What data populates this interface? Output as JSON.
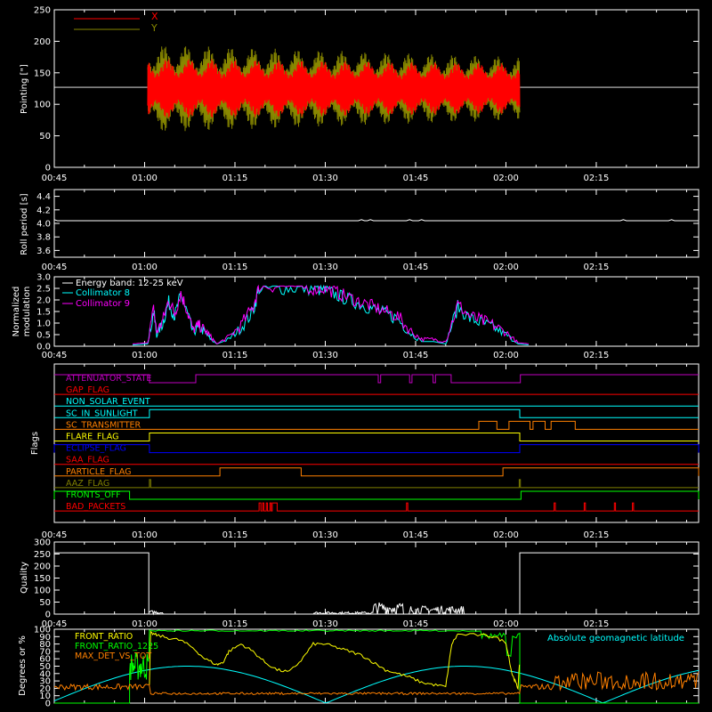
{
  "time_axis": {
    "start_min": 45,
    "end_min": 152,
    "tick_minutes": [
      45,
      60,
      75,
      90,
      105,
      120,
      135
    ],
    "tick_labels": [
      "00:45",
      "01:00",
      "01:15",
      "01:30",
      "01:45",
      "02:00",
      "02:15"
    ]
  },
  "colors": {
    "x": "#ff0000",
    "y": "#888800",
    "white": "#ffffff",
    "cyan": "#00ffff",
    "magenta": "#ff00ff",
    "yellow": "#ffff00",
    "green": "#00ff00",
    "orange": "#ff8000",
    "red": "#ff0000",
    "blue": "#0000ff",
    "olive": "#808000",
    "purple": "#c000c0"
  },
  "chart_data": [
    {
      "type": "line",
      "ylabel": "Pointing [\"]",
      "ylim": [
        0,
        250
      ],
      "yticks": [
        "0",
        "50",
        "100",
        "150",
        "200",
        "250"
      ],
      "reference_level": 127,
      "legend_position": "top-left",
      "series": [
        {
          "name": "X",
          "color": "#ff0000",
          "t_start": 60.5,
          "t_end": 122.3,
          "center": 125,
          "amplitude_start": 48,
          "amplitude_end": 40
        },
        {
          "name": "Y",
          "color": "#888800",
          "t_start": 60.5,
          "t_end": 122.3,
          "center": 125,
          "amplitude_start": 70,
          "amplitude_end": 50
        }
      ]
    },
    {
      "type": "line",
      "ylabel": "Roll period [s]",
      "ylim": [
        3.5,
        4.5
      ],
      "yticks": [
        "3.6",
        "3.8",
        "4.0",
        "4.2",
        "4.4"
      ],
      "series": [
        {
          "name": "",
          "color": "#ffffff",
          "value": 4.04
        }
      ]
    },
    {
      "type": "line",
      "ylabel": "Normalized modulation",
      "ylim": [
        0,
        3.0
      ],
      "yticks": [
        "0.0",
        "0.5",
        "1.0",
        "1.5",
        "2.0",
        "2.5",
        "3.0"
      ],
      "legend_position": "top-left",
      "legend_title": "Energy band: 12-25 keV",
      "series": [
        {
          "name": "Collimator 8",
          "color": "#00ffff",
          "points": [
            [
              58,
              0.05
            ],
            [
              60.5,
              0.1
            ],
            [
              61.5,
              1.5
            ],
            [
              62,
              0.5
            ],
            [
              63,
              1.0
            ],
            [
              64,
              1.9
            ],
            [
              65,
              1.3
            ],
            [
              66,
              2.2
            ],
            [
              67,
              1.5
            ],
            [
              68,
              0.6
            ],
            [
              69,
              0.8
            ],
            [
              70,
              0.6
            ],
            [
              71,
              0.3
            ],
            [
              72,
              0.1
            ],
            [
              74,
              0.3
            ],
            [
              76,
              0.8
            ],
            [
              78,
              1.5
            ],
            [
              79,
              2.5
            ],
            [
              82,
              2.5
            ],
            [
              85,
              2.5
            ],
            [
              88,
              2.5
            ],
            [
              90,
              2.4
            ],
            [
              92,
              2.2
            ],
            [
              94,
              2.0
            ],
            [
              96,
              1.8
            ],
            [
              98,
              1.6
            ],
            [
              100,
              1.4
            ],
            [
              102,
              1.2
            ],
            [
              104,
              0.6
            ],
            [
              106,
              0.2
            ],
            [
              108,
              0.2
            ],
            [
              110,
              0.1
            ],
            [
              112,
              1.7
            ],
            [
              114,
              1.2
            ],
            [
              116,
              1.0
            ],
            [
              118,
              0.8
            ],
            [
              120,
              0.5
            ],
            [
              122,
              0.1
            ],
            [
              124,
              0.05
            ]
          ]
        },
        {
          "name": "Collimator 9",
          "color": "#ff00ff",
          "points": [
            [
              58,
              0.1
            ],
            [
              60.5,
              0.15
            ],
            [
              61.5,
              1.6
            ],
            [
              62,
              0.6
            ],
            [
              63,
              1.1
            ],
            [
              64,
              2.0
            ],
            [
              65,
              1.4
            ],
            [
              66,
              2.3
            ],
            [
              67,
              1.6
            ],
            [
              68,
              0.7
            ],
            [
              69,
              0.9
            ],
            [
              70,
              0.7
            ],
            [
              71,
              0.4
            ],
            [
              72,
              0.1
            ],
            [
              74,
              0.4
            ],
            [
              76,
              0.9
            ],
            [
              78,
              1.7
            ],
            [
              79,
              2.6
            ],
            [
              82,
              2.6
            ],
            [
              85,
              2.6
            ],
            [
              88,
              2.5
            ],
            [
              90,
              2.5
            ],
            [
              92,
              2.3
            ],
            [
              94,
              2.1
            ],
            [
              96,
              1.9
            ],
            [
              98,
              1.7
            ],
            [
              100,
              1.5
            ],
            [
              102,
              1.3
            ],
            [
              104,
              0.7
            ],
            [
              106,
              0.3
            ],
            [
              108,
              0.3
            ],
            [
              110,
              0.2
            ],
            [
              112,
              1.8
            ],
            [
              114,
              1.3
            ],
            [
              116,
              1.1
            ],
            [
              118,
              0.9
            ],
            [
              120,
              0.6
            ],
            [
              122,
              0.15
            ],
            [
              124,
              0.1
            ]
          ]
        }
      ]
    },
    {
      "type": "line",
      "ylabel": "Flags",
      "flags": [
        {
          "name": "ATTENUATOR_STATE",
          "color": "#c000c0",
          "high_intervals": [
            [
              45,
              60.8
            ],
            [
              68.5,
              98.8
            ],
            [
              99.2,
              104
            ],
            [
              104.4,
              107.9
            ],
            [
              108.3,
              110.9
            ],
            [
              111.3,
              122.4
            ],
            [
              122.4,
              152
            ]
          ],
          "base_state": "high_default"
        },
        {
          "name": "GAP_FLAG",
          "color": "#ff0000",
          "high_intervals": []
        },
        {
          "name": "NON_SOLAR_EVENT",
          "color": "#00ffff",
          "high_intervals": []
        },
        {
          "name": "SC_IN_SUNLIGHT",
          "color": "#00ffff",
          "high_intervals": [
            [
              60.8,
              122.3
            ]
          ]
        },
        {
          "name": "SC_TRANSMITTER",
          "color": "#ff8000",
          "high_intervals": [
            [
              115.5,
              118.5
            ],
            [
              120.5,
              124
            ],
            [
              124.5,
              126.5
            ],
            [
              127.5,
              131.5
            ]
          ]
        },
        {
          "name": "FLARE_FLAG",
          "color": "#ffff00",
          "high_intervals": [
            [
              60.8,
              122.3
            ]
          ]
        },
        {
          "name": "ECLIPSE_FLAG",
          "color": "#0000ff",
          "high_intervals": [
            [
              45,
              60.8
            ],
            [
              122.3,
              152
            ]
          ]
        },
        {
          "name": "SAA_FLAG",
          "color": "#ff0000",
          "high_intervals": []
        },
        {
          "name": "PARTICLE_FLAG",
          "color": "#ff8000",
          "high_intervals": [
            [
              72.5,
              86
            ],
            [
              119.5,
              152
            ]
          ]
        },
        {
          "name": "AAZ_FLAG",
          "color": "#808000",
          "high_intervals": [
            [
              60.8,
              61
            ],
            [
              122.2,
              122.4
            ]
          ]
        },
        {
          "name": "FRONTS_OFF",
          "color": "#00ff00",
          "high_intervals": [
            [
              45,
              57.5
            ],
            [
              122.5,
              152
            ]
          ]
        },
        {
          "name": "BAD_PACKETS",
          "color": "#ff0000",
          "high_intervals": [
            [
              79,
              79.3
            ],
            [
              79.6,
              79.8
            ],
            [
              80.2,
              80.4
            ],
            [
              80.8,
              81
            ],
            [
              81.2,
              82
            ],
            [
              103.5,
              103.7
            ],
            [
              128,
              128.2
            ],
            [
              133,
              133.2
            ],
            [
              138,
              138.2
            ],
            [
              141,
              141.2
            ]
          ]
        }
      ]
    },
    {
      "type": "line",
      "ylabel": "Quality",
      "ylim": [
        0,
        300
      ],
      "yticks": [
        "0",
        "50",
        "100",
        "150",
        "200",
        "250",
        "300"
      ],
      "series": [
        {
          "name": "",
          "color": "#ffffff"
        }
      ]
    },
    {
      "type": "line",
      "ylabel": "Degrees or %",
      "ylim": [
        0,
        100
      ],
      "yticks": [
        "0",
        "10",
        "20",
        "30",
        "40",
        "50",
        "60",
        "70",
        "80",
        "90",
        "100"
      ],
      "legend_position": "top-left",
      "series": [
        {
          "name": "FRONT_RATIO",
          "color": "#ffff00"
        },
        {
          "name": "FRONT_RATIO_1225",
          "color": "#00ff00"
        },
        {
          "name": "MAX_DET_VS_TOT",
          "color": "#ff8000"
        },
        {
          "name": "Absolute geomagnetic latitude",
          "color": "#00ffff"
        }
      ]
    }
  ],
  "labels": {
    "attenuator": "ATTENUATOR_STATE",
    "gap": "GAP_FLAG",
    "nonsolar": "NON_SOLAR_EVENT",
    "sunlight": "SC_IN_SUNLIGHT",
    "transmitter": "SC_TRANSMITTER",
    "flare": "FLARE_FLAG",
    "eclipse": "ECLIPSE_FLAG",
    "saa": "SAA_FLAG",
    "particle": "PARTICLE_FLAG",
    "aaz": "AAZ_FLAG",
    "fronts": "FRONTS_OFF",
    "badpackets": "BAD_PACKETS"
  }
}
